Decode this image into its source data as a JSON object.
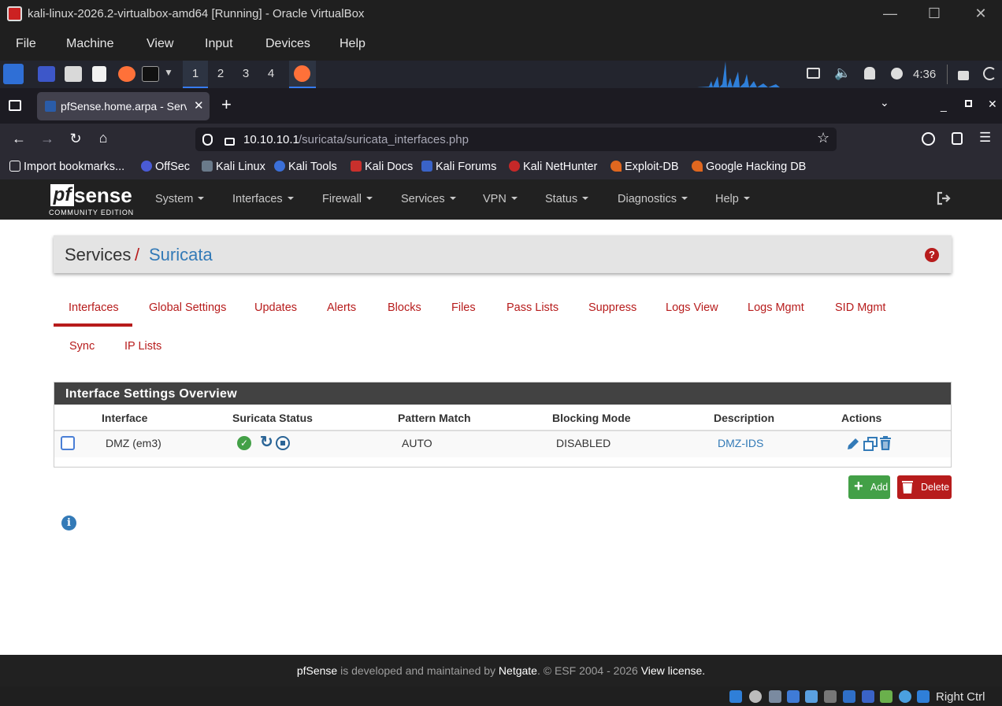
{
  "vbox": {
    "title": "kali-linux-2026.2-virtualbox-amd64 [Running] - Oracle VirtualBox",
    "menu": [
      "File",
      "Machine",
      "View",
      "Input",
      "Devices",
      "Help"
    ],
    "host_key": "Right Ctrl"
  },
  "kali": {
    "workspaces": [
      "1",
      "2",
      "3",
      "4"
    ],
    "clock": "4:36"
  },
  "browser": {
    "tab_title": "pfSense.home.arpa - Serv",
    "url_host": "10.10.10.1",
    "url_path": "/suricata/suricata_interfaces.php",
    "bookmarks": [
      "Import bookmarks...",
      "OffSec",
      "Kali Linux",
      "Kali Tools",
      "Kali Docs",
      "Kali Forums",
      "Kali NetHunter",
      "Exploit-DB",
      "Google Hacking DB"
    ]
  },
  "pfsense": {
    "logo_main": "sense",
    "logo_pf": "pf",
    "logo_sub": "COMMUNITY EDITION",
    "menu": [
      "System",
      "Interfaces",
      "Firewall",
      "Services",
      "VPN",
      "Status",
      "Diagnostics",
      "Help"
    ],
    "breadcrumb": {
      "parent": "Services",
      "sep": "/",
      "current": "Suricata"
    },
    "help_icon": "question-circle-icon",
    "tabs_row1": [
      "Interfaces",
      "Global Settings",
      "Updates",
      "Alerts",
      "Blocks",
      "Files",
      "Pass Lists",
      "Suppress",
      "Logs View",
      "Logs Mgmt",
      "SID Mgmt"
    ],
    "tabs_row2": [
      "Sync",
      "IP Lists"
    ],
    "active_tab": "Interfaces",
    "panel_title": "Interface Settings Overview",
    "columns": [
      "Interface",
      "Suricata Status",
      "Pattern Match",
      "Blocking Mode",
      "Description",
      "Actions"
    ],
    "rows": [
      {
        "interface": "DMZ (em3)",
        "pattern": "AUTO",
        "blocking": "DISABLED",
        "description": "DMZ-IDS"
      }
    ],
    "add_label": "Add",
    "delete_label": "Delete",
    "footer": {
      "brand": "pfSense",
      "mid": " is developed and maintained by ",
      "company": "Netgate",
      "copy": ". © ESF 2004 - 2026 ",
      "license": "View license."
    }
  },
  "colors": {
    "accent_red": "#b71c1c",
    "link_blue": "#337ab7",
    "success_green": "#43a047"
  }
}
